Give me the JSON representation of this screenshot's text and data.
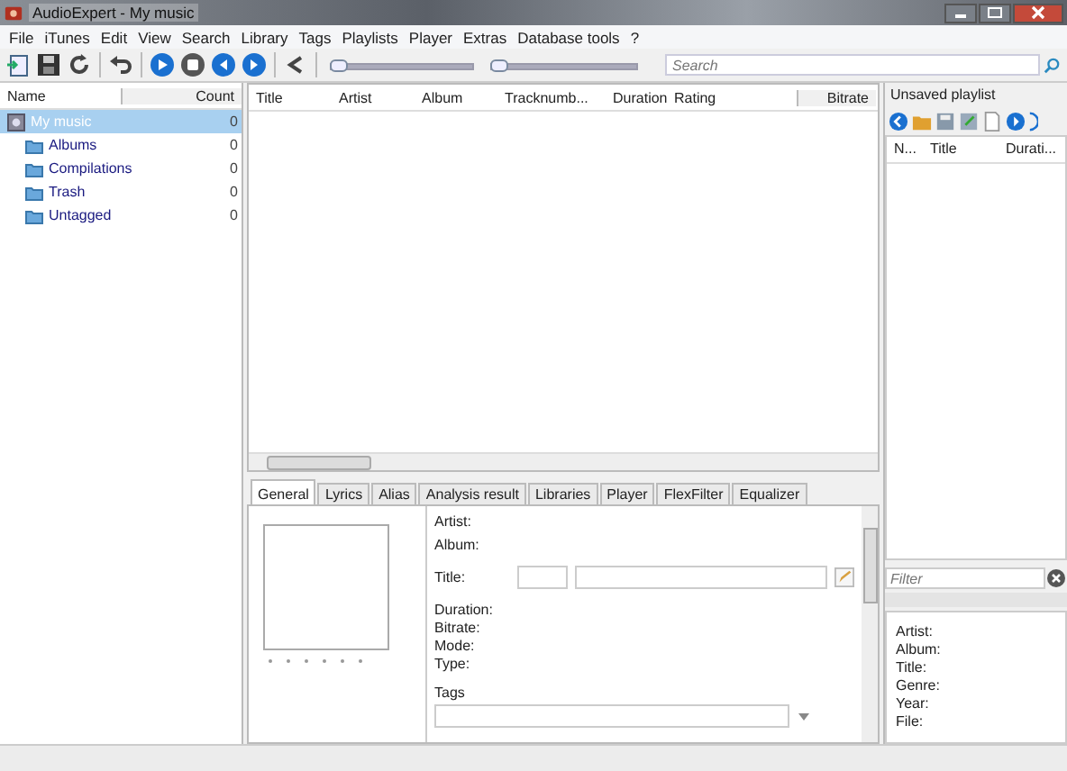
{
  "window": {
    "title": "AudioExpert - My music"
  },
  "menu": [
    "File",
    "iTunes",
    "Edit",
    "View",
    "Search",
    "Library",
    "Tags",
    "Playlists",
    "Player",
    "Extras",
    "Database tools",
    "?"
  ],
  "toolbar": {
    "sliders": [
      {
        "level": 0.0
      },
      {
        "level": 0.0
      }
    ],
    "search": {
      "placeholder": "Search"
    }
  },
  "library": {
    "columns": [
      "Name",
      "Count"
    ],
    "items": [
      {
        "name": "My music",
        "count": "0",
        "selected": true,
        "children": [
          {
            "name": "Albums",
            "count": "0",
            "selected": false
          },
          {
            "name": "Compilations",
            "count": "0",
            "selected": false
          },
          {
            "name": "Trash",
            "count": "0",
            "selected": false
          },
          {
            "name": "Untagged",
            "count": "0",
            "selected": false
          }
        ]
      }
    ]
  },
  "tracks": {
    "columns": [
      "Title",
      "Artist",
      "Album",
      "Tracknumb...",
      "Duration",
      "Rating",
      "Bitrate"
    ]
  },
  "tabs": [
    {
      "label": "General",
      "selected": true
    },
    {
      "label": "Lyrics",
      "selected": false
    },
    {
      "label": "Alias",
      "selected": false
    },
    {
      "label": "Analysis result",
      "selected": false
    },
    {
      "label": "Libraries",
      "selected": false
    },
    {
      "label": "Player",
      "selected": false
    },
    {
      "label": "FlexFilter",
      "selected": false
    },
    {
      "label": "Equalizer",
      "selected": false
    }
  ],
  "general": {
    "labels_top": [
      "Artist:",
      "Album:"
    ],
    "title_label": "Title:",
    "labels_bottom": [
      "Duration:",
      "Bitrate:",
      "Mode:",
      "Type:"
    ],
    "tags_label": "Tags"
  },
  "playlist": {
    "title": "Unsaved playlist",
    "columns": [
      "N...",
      "Title",
      "Durati..."
    ],
    "filter": {
      "placeholder": "Filter"
    },
    "info": [
      "Artist:",
      "Album:",
      "Title:",
      "Genre:",
      "Year:",
      "File:"
    ]
  }
}
